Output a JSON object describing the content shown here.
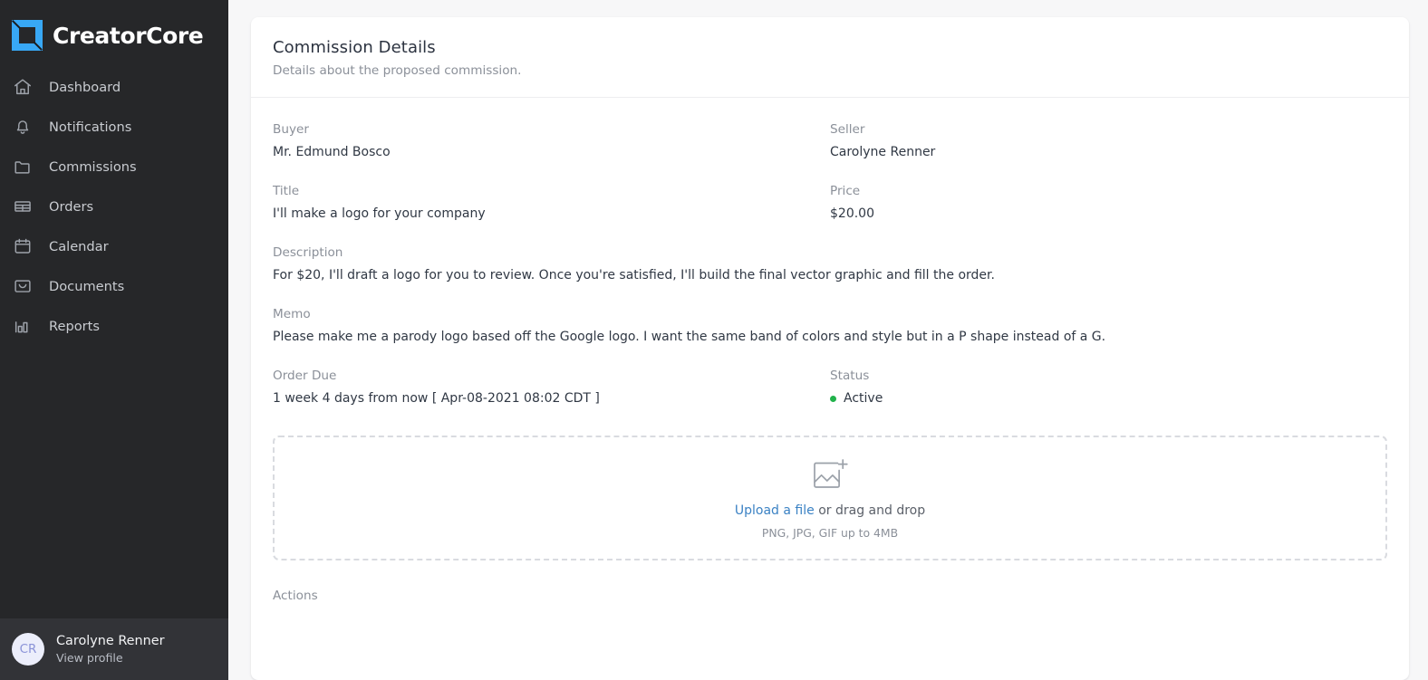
{
  "brand": {
    "name": "CreatorCore",
    "logo_icon": "square-logo-icon",
    "accent": "#38a8f5"
  },
  "sidebar": {
    "items": [
      {
        "label": "Dashboard",
        "icon": "home-icon"
      },
      {
        "label": "Notifications",
        "icon": "bell-icon"
      },
      {
        "label": "Commissions",
        "icon": "folder-icon"
      },
      {
        "label": "Orders",
        "icon": "table-icon"
      },
      {
        "label": "Calendar",
        "icon": "calendar-icon"
      },
      {
        "label": "Documents",
        "icon": "inbox-icon"
      },
      {
        "label": "Reports",
        "icon": "bar-chart-icon"
      }
    ],
    "profile": {
      "initials": "CR",
      "name": "Carolyne Renner",
      "link": "View profile",
      "avatar_icon": "avatar"
    }
  },
  "main": {
    "header": {
      "title": "Commission Details",
      "subtitle": "Details about the proposed commission."
    },
    "fields": {
      "buyer_label": "Buyer",
      "buyer_value": "Mr. Edmund Bosco",
      "seller_label": "Seller",
      "seller_value": "Carolyne Renner",
      "title_label": "Title",
      "title_value": "I'll make a logo for your company",
      "price_label": "Price",
      "price_value": "$20.00",
      "description_label": "Description",
      "description_value": "For $20, I'll draft a logo for you to review. Once you're satisfied, I'll build the final vector graphic and fill the order.",
      "memo_label": "Memo",
      "memo_value": "Please make me a parody logo based off the Google logo. I want the same band of colors and style but in a P shape instead of a G.",
      "order_due_label": "Order Due",
      "order_due_value": "1 week 4 days from now [ Apr-08-2021 08:02 CDT ]",
      "status_label": "Status",
      "status_value": "Active",
      "status_color": "#21b24b"
    },
    "upload": {
      "icon": "image-add-icon",
      "link_text": "Upload a file",
      "rest_text": " or drag and drop",
      "hint": "PNG, JPG, GIF up to 4MB",
      "link_color": "#3b82c4"
    },
    "actions_label": "Actions"
  }
}
